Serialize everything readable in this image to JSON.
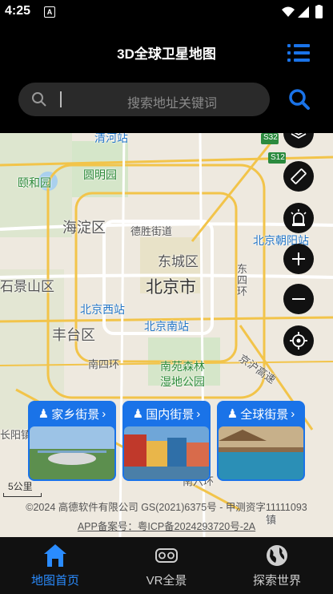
{
  "status_bar": {
    "time": "4:25",
    "notification_badge": "A"
  },
  "header": {
    "title": "3D全球卫星地图"
  },
  "search": {
    "placeholder": "搜索地址关键词"
  },
  "map_labels": {
    "qinghe": "清河站",
    "yiheyuan": "颐和园",
    "yuanmingyuan": "圆明园",
    "haidian": "海淀区",
    "deshengjie": "德胜街道",
    "beijing_chaoyang": "北京朝阳站",
    "dongcheng": "东城区",
    "shijingshan": "石景山区",
    "beijing_city": "北京市",
    "dongsihuan": "东四环",
    "beijing_west": "北京西站",
    "fengtai": "丰台区",
    "beijing_south": "北京南站",
    "nansihuan": "南四环",
    "nanyuan_forest": "南苑森林",
    "wetland_park": "湿地公园",
    "jinghu_highway": "京沪高速",
    "changyang": "长阳镇",
    "hu_town": "镇",
    "nanliu": "南六环",
    "road_s32": "S32",
    "road_s12": "S12",
    "scale": "5公里"
  },
  "street_view_cards": [
    {
      "label": "家乡街景"
    },
    {
      "label": "国内街景"
    },
    {
      "label": "全球街景"
    }
  ],
  "copyright": "©2024 高德软件有限公司 GS(2021)6375号 - 甲测资字11111093",
  "icp": "APP备案号：粤ICP备2024293720号-2A",
  "tabs": [
    {
      "label": "地图首页",
      "active": true
    },
    {
      "label": "VR全景",
      "active": false
    },
    {
      "label": "探索世界",
      "active": false
    }
  ],
  "colors": {
    "accent": "#1a73e8",
    "tab_active": "#2a8cff",
    "tab_inactive": "#cfcfcf"
  }
}
